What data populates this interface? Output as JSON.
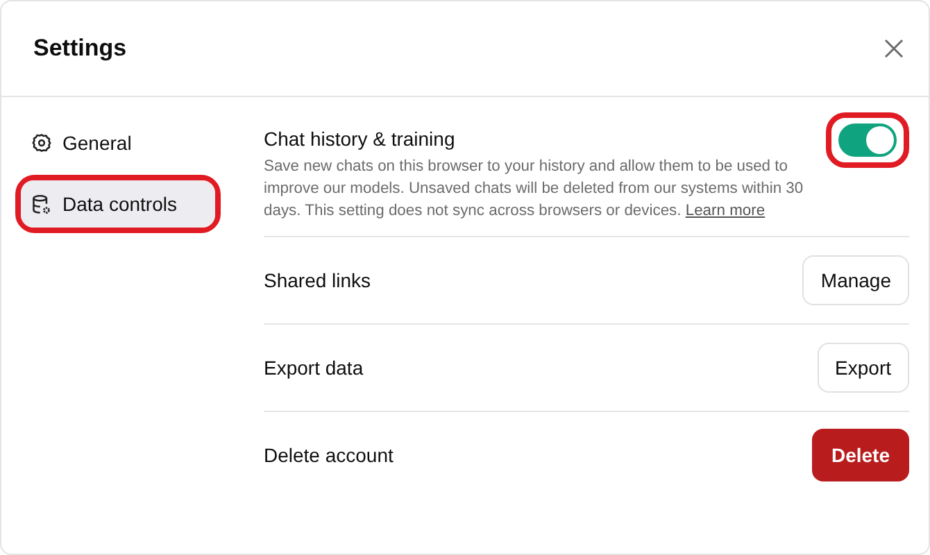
{
  "dialog": {
    "title": "Settings"
  },
  "sidebar": {
    "items": [
      {
        "label": "General",
        "kind": "gear",
        "selected": false,
        "highlighted": false
      },
      {
        "label": "Data controls",
        "kind": "database",
        "selected": true,
        "highlighted": true
      }
    ]
  },
  "settings": [
    {
      "kind": "toggle",
      "label": "Chat history & training",
      "description": "Save new chats on this browser to your history and allow them to be used to improve our models. Unsaved chats will be deleted from our systems within 30 days. This setting does not sync across browsers or devices.",
      "link": "Learn more",
      "on": true,
      "highlighted": true
    },
    {
      "kind": "button",
      "label": "Shared links",
      "button": "Manage",
      "danger": false
    },
    {
      "kind": "button",
      "label": "Export data",
      "button": "Export",
      "danger": false
    },
    {
      "kind": "button",
      "label": "Delete account",
      "button": "Delete",
      "danger": true
    }
  ]
}
